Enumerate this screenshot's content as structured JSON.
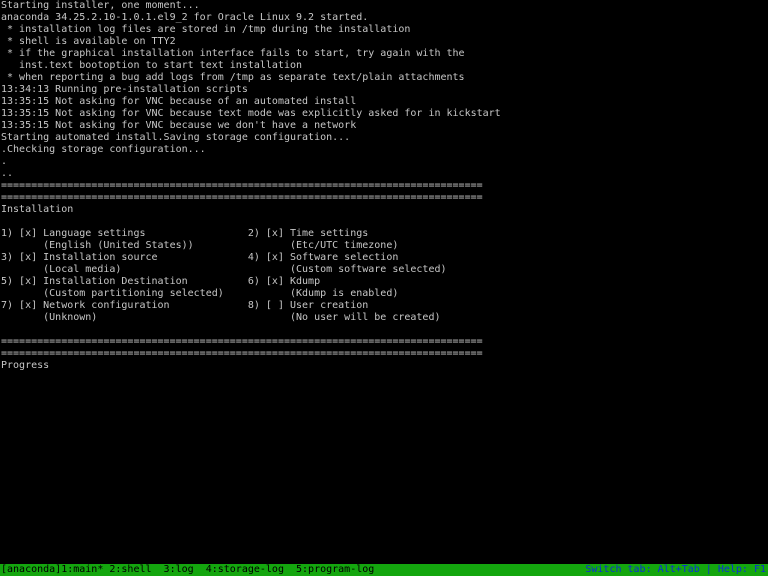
{
  "colors": {
    "background": "#000000",
    "text": "#c7c7c7",
    "statusbar_bg": "#14a60e",
    "statusbar_text": "#000000",
    "help_text": "#0b2fd6"
  },
  "console": {
    "lines": [
      "Starting installer, one moment...",
      "anaconda 34.25.2.10-1.0.1.el9_2 for Oracle Linux 9.2 started.",
      " * installation log files are stored in /tmp during the installation",
      " * shell is available on TTY2",
      " * if the graphical installation interface fails to start, try again with the",
      "   inst.text bootoption to start text installation",
      " * when reporting a bug add logs from /tmp as separate text/plain attachments",
      "13:34:13 Running pre-installation scripts",
      "13:35:15 Not asking for VNC because of an automated install",
      "13:35:15 Not asking for VNC because text mode was explicitly asked for in kickstart",
      "13:35:15 Not asking for VNC because we don't have a network",
      "Starting automated install.Saving storage configuration...",
      ".Checking storage configuration...",
      ".",
      "..",
      "================================================================================",
      "================================================================================",
      "Installation",
      "",
      "1) [x] Language settings                 2) [x] Time settings",
      "       (English (United States))                (Etc/UTC timezone)",
      "3) [x] Installation source               4) [x] Software selection",
      "       (Local media)                            (Custom software selected)",
      "5) [x] Installation Destination          6) [x] Kdump",
      "       (Custom partitioning selected)           (Kdump is enabled)",
      "7) [x] Network configuration             8) [ ] User creation",
      "       (Unknown)                                (No user will be created)",
      "",
      "================================================================================",
      "================================================================================",
      "Progress"
    ]
  },
  "statusbar": {
    "left": "[anaconda]1:main* 2:shell  3:log  4:storage-log  5:program-log",
    "right": "Switch tab: Alt+Tab | Help: F1"
  }
}
